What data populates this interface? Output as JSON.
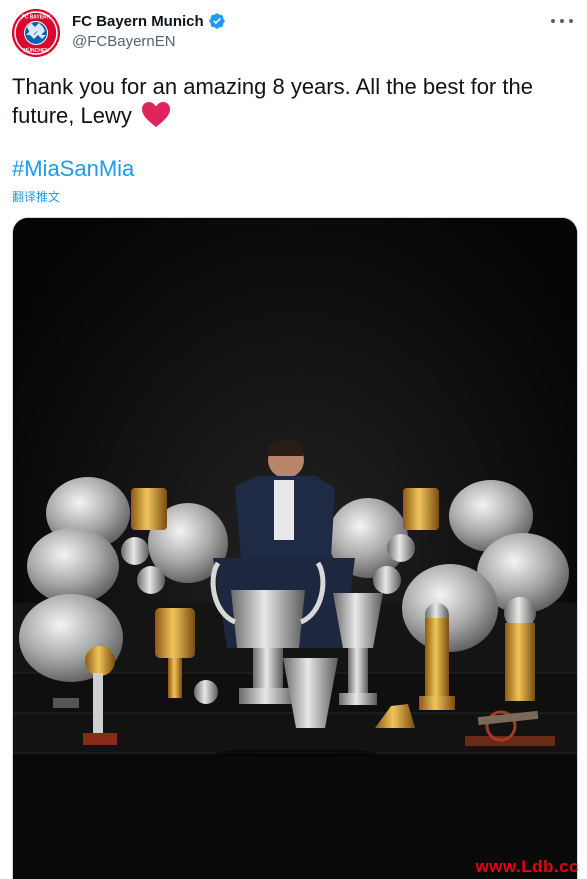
{
  "account": {
    "display_name": "FC Bayern Munich",
    "handle": "@FCBayernEN",
    "verified_icon": "verified-badge-icon",
    "avatar_icon": "fc-bayern-crest-icon"
  },
  "tweet": {
    "text": "Thank you for an amazing 8 years. All the best for the future, Lewy",
    "emoji": "heart-icon",
    "hashtag": "#MiaSanMia",
    "translate_label": "翻译推文"
  },
  "media": {
    "description_icon": "trophy-photo"
  },
  "watermark": "www.Ldb.cc",
  "colors": {
    "link_blue": "#1d9bf0",
    "bayern_red": "#dc052d",
    "heart_red": "#e0245e",
    "watermark_red": "#e60012"
  }
}
